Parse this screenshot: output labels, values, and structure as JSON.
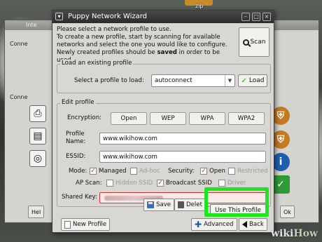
{
  "desktop": {
    "zip_label": "zip",
    "watermark": {
      "wiki": "wiki",
      "how": "How"
    }
  },
  "background_window": {
    "title": "Inte",
    "side_label_1": "Conne",
    "side_label_2": "Conne",
    "help_button": "Hel",
    "ok_button": "Ok"
  },
  "dialog": {
    "title": "Puppy Network Wizard",
    "intro": {
      "line1": "Please select a network profile to use.",
      "line2": "To create a new profile, start by scanning for available",
      "line3": "networks and select the one you would like to configure.",
      "line4_pre": "Newly created profiles should be ",
      "line4_bold": "saved",
      "line4_post": " in order to be used."
    },
    "scan_button": "Scan",
    "load_group": {
      "legend": "Load an existing profile",
      "select_label": "Select a profile to load:",
      "selected_profile": "autoconnect",
      "load_button": "Load"
    },
    "edit_group": {
      "legend": "Edit profile",
      "encryption_label": "Encryption:",
      "encryption_options": [
        "Open",
        "WEP",
        "WPA",
        "WPA2"
      ],
      "profile_name_label_1": "Profile",
      "profile_name_label_2": "Name:",
      "profile_name_value": "www.wikihow.com",
      "essid_label": "ESSID:",
      "essid_value": "www.wikihow.com",
      "mode_label": "Mode:",
      "mode_managed": "Managed",
      "mode_adhoc": "Ad-hoc",
      "security_label": "Security:",
      "security_open": "Open",
      "security_restricted": "Restricted",
      "ap_scan_label": "AP Scan:",
      "hidden_ssid": "Hidden SSID",
      "broadcast_ssid": "Broadcast SSID",
      "driver": "Driver",
      "shared_key_label": "Shared Key:",
      "save_button": "Save",
      "delete_button": "Delet",
      "use_profile_button": "Use This Profile"
    },
    "bottom": {
      "new_profile_button": "New Profile",
      "advanced_button": "Advanced",
      "back_button": "Back"
    }
  },
  "colors": {
    "highlight": "#1ee61e",
    "checkmark_red": "#c0262a",
    "check_green": "#1f9b2a"
  }
}
